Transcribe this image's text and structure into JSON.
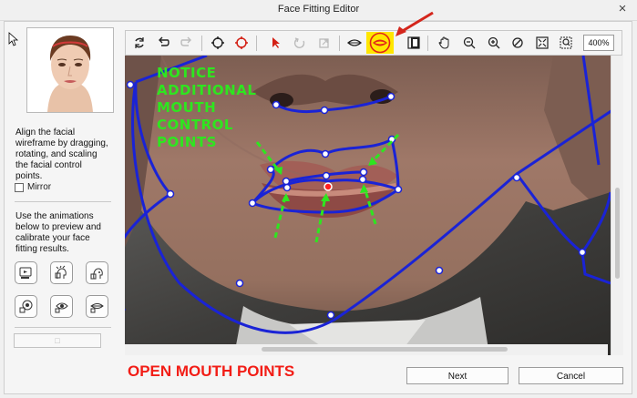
{
  "window": {
    "title": "Face Fitting Editor",
    "close_glyph": "×"
  },
  "left_panel": {
    "instructions": "Align the facial wireframe by dragging, rotating, and scaling the facial control points.",
    "mirror_label": "Mirror",
    "mirror_checked": false,
    "animations_text": "Use the animations below to preview and calibrate your face fitting results.",
    "animation_buttons": [
      "talk-animation-icon",
      "expression-animation-icon",
      "head-turn-animation-icon",
      "eye-animation-icon",
      "blink-animation-icon",
      "mouth-animation-icon"
    ]
  },
  "toolbar": {
    "icons": [
      "reset-icon",
      "undo-icon",
      "redo-icon",
      "rotate-icon",
      "scale-icon",
      "select-arrow-icon",
      "lasso-icon",
      "crop-icon",
      "mouth-open-icon",
      "mouth-closed-icon",
      "mask-icon",
      "hand-pan-icon",
      "zoom-out-icon",
      "zoom-in-icon",
      "zoom-actual-icon",
      "fit-view-icon",
      "zoom-region-icon"
    ],
    "zoom_value": "400%",
    "highlight_color": "#ffe600",
    "circle_color": "#e2231a"
  },
  "annotation": {
    "notice_lines": [
      "NOTICE",
      "ADDITIONAL",
      "MOUTH",
      "CONTROL",
      "POINTS"
    ],
    "notice_color": "#2ee61f",
    "caption": "OPEN MOUTH POINTS",
    "caption_color": "#f21d16",
    "arrow_color_green": "#2ee61f",
    "arrow_color_red": "#d4261c"
  },
  "wireframe": {
    "line_color": "#1a23d6",
    "point_color": "#ffffff",
    "active_point_color": "#ff2020"
  },
  "buttons": {
    "next_label": "Next",
    "cancel_label": "Cancel"
  }
}
